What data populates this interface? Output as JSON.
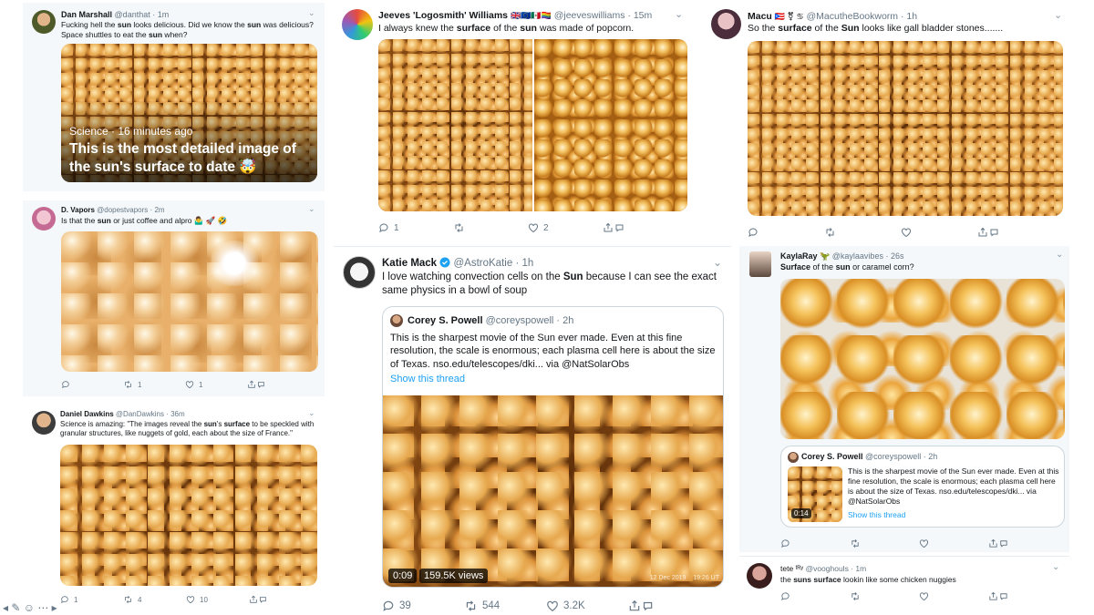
{
  "tweets": {
    "dan": {
      "name": "Dan Marshall",
      "handle": "@danthat",
      "time": "1m",
      "text_html": "Fucking hell the <b>sun</b> looks delicious. Did we know the <b>sun</b> was delicious? Space shuttles to eat the <b>sun</b> when?",
      "card_meta": "Science · 16 minutes ago",
      "card_title": "This is the most detailed image of the sun's surface to date 🤯"
    },
    "dvapors": {
      "name": "D. Vapors",
      "handle": "@dopestvapors",
      "time": "2m",
      "text_html": "Is that the <b>sun</b> or just coffee and alpro 🤷‍♂️ 🚀 🤣",
      "replies": "",
      "retweets": "1",
      "likes": "1"
    },
    "daniel": {
      "name": "Daniel Dawkins",
      "handle": "@DanDawkins",
      "time": "36m",
      "text_html": "Science is amazing: \"The images reveal the <b>sun</b>'s <b>surface</b> to be speckled with granular structures, like nuggets of gold, each about the size of France.\"",
      "replies": "1",
      "retweets": "4",
      "likes": "10"
    },
    "jeeves": {
      "name": "Jeeves 'Logosmith' Williams",
      "flags": "🇬🇧🇪🇺🇲🇽🏳️‍🌈",
      "handle": "@jeeveswilliams",
      "time": "15m",
      "text_html": "I always knew the <b>surface</b> of the <b>sun</b> was made of popcorn.",
      "replies": "1",
      "retweets": "",
      "likes": "2"
    },
    "katie": {
      "name": "Katie Mack",
      "handle": "@AstroKatie",
      "time": "1h",
      "text_html": "I love watching convection cells on the <b>Sun</b> because I can see the exact same physics in a bowl of soup",
      "quote": {
        "name": "Corey S. Powell",
        "handle": "@coreyspowell",
        "time": "2h",
        "text": "This is the sharpest movie of the Sun ever made. Even at this fine resolution, the scale is enormous; each plasma cell here is about the size of Texas. nso.edu/telescopes/dki... via @NatSolarObs",
        "show_thread": "Show this thread",
        "video_time": "0:09",
        "views": "159.5K views",
        "video_caption": "12 Dec 2019    19:26 UT"
      },
      "replies": "39",
      "retweets": "544",
      "likes": "3.2K"
    },
    "macu": {
      "name": "Macu",
      "flags": "🇵🇷 ⚧ ♋",
      "handle": "@MacutheBookworm",
      "time": "1h",
      "text_html": "So the <b>surface</b> of the <b>Sun</b> looks like gall bladder stones......."
    },
    "kayla": {
      "name": "KaylaRay",
      "emoji": "🦖",
      "handle": "@kaylaavibes",
      "time": "26s",
      "text_html": "<b>Surface</b> of the <b>sun</b> or caramel corn?",
      "quote": {
        "name": "Corey S. Powell",
        "handle": "@coreyspowell",
        "time": "2h",
        "text": "This is the sharpest movie of the Sun ever made. Even at this fine resolution, the scale is enormous; each plasma cell here is about the size of Texas. nso.edu/telescopes/dki... via @NatSolarObs",
        "show_thread": "Show this thread",
        "video_time": "0:14"
      }
    },
    "tete": {
      "name": "tete ᶠᴿʸ",
      "handle": "@vooghouls",
      "time": "1m",
      "text_html": "the <b>suns</b> <b>surface</b> lookin like some chicken nuggies"
    }
  },
  "colors": {
    "link": "#1da1f2",
    "muted": "#657786",
    "text": "#14171a"
  },
  "icons": [
    "reply-icon",
    "retweet-icon",
    "like-icon",
    "share-icon",
    "chevron-down-icon",
    "verified-icon"
  ]
}
